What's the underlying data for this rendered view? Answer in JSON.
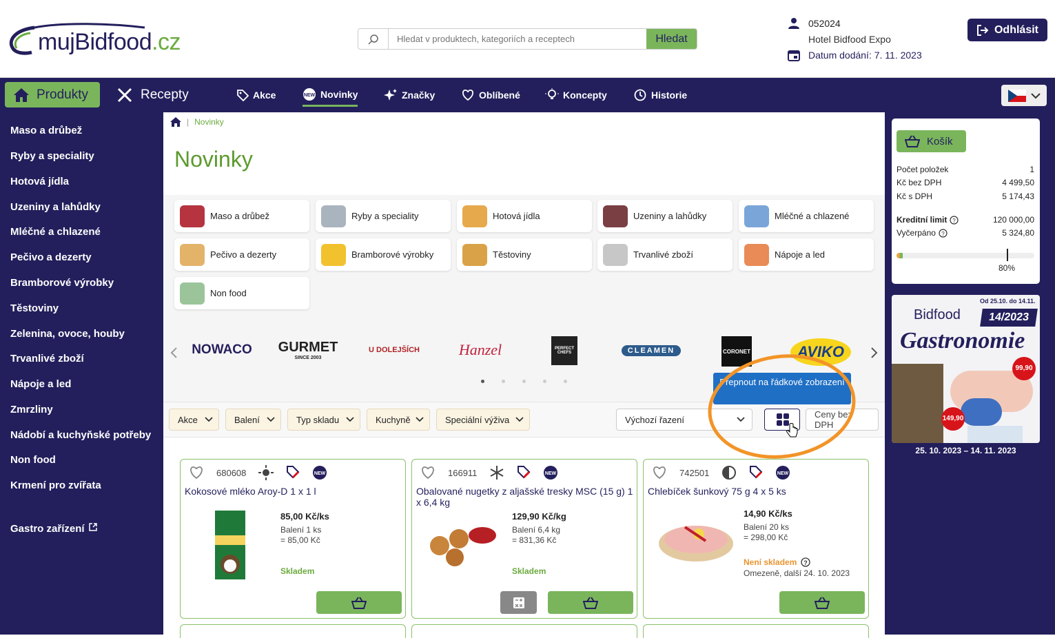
{
  "header": {
    "logo_main": "mujBidfood",
    "logo_suffix": ".cz",
    "search_placeholder": "Hledat v produktech, kategoriích a receptech",
    "search_button": "Hledat",
    "account_id": "052024",
    "account_name": "Hotel Bidfood Expo",
    "delivery_date": "Datum dodání: 7. 11. 2023",
    "logout_label": "Odhlásit"
  },
  "nav": {
    "products": "Produkty",
    "recipes": "Recepty",
    "items": [
      {
        "label": "Akce",
        "icon": "tag-icon"
      },
      {
        "label": "Novinky",
        "icon": "new-badge-icon",
        "active": true
      },
      {
        "label": "Značky",
        "icon": "sparkle-icon"
      },
      {
        "label": "Oblíbené",
        "icon": "heart-icon"
      },
      {
        "label": "Koncepty",
        "icon": "bulb-icon"
      },
      {
        "label": "Historie",
        "icon": "history-icon"
      }
    ]
  },
  "sidebar": {
    "categories": [
      "Maso a drůbež",
      "Ryby a speciality",
      "Hotová jídla",
      "Uzeniny a lahůdky",
      "Mléčné a chlazené",
      "Pečivo a dezerty",
      "Bramborové výrobky",
      "Těstoviny",
      "Zelenina, ovoce, houby",
      "Trvanlivé zboží",
      "Nápoje a led",
      "Zmrzliny",
      "Nádobí a kuchyňské potřeby",
      "Non food",
      "Krmení pro zvířata"
    ],
    "gastro": "Gastro zařízení"
  },
  "breadcrumb": {
    "current": "Novinky"
  },
  "page_title": "Novinky",
  "category_tiles": [
    "Maso a drůbež",
    "Ryby a speciality",
    "Hotová jídla",
    "Uzeniny a lahůdky",
    "Mléčné a chlazené",
    "Pečivo a dezerty",
    "Bramborové výrobky",
    "Těstoviny",
    "Trvanlivé zboží",
    "Nápoje a led",
    "Non food"
  ],
  "brands": [
    "NOWACO",
    "GURMET",
    "U DOLEJŠÍCH",
    "Hanzel",
    "PERFECT CHEFS",
    "CLEAMEN",
    "CORONET",
    "AVIKO"
  ],
  "brands_extra": {
    "gurmet_since": "SINCE 2003"
  },
  "filters": [
    "Akce",
    "Balení",
    "Typ skladu",
    "Kuchyně",
    "Speciální výživa"
  ],
  "sort": {
    "label": "Výchozí řazení",
    "price_toggle": "Ceny bez DPH"
  },
  "tooltip": "Přepnout na řádkové zobrazení",
  "products": [
    {
      "code": "680608",
      "name": "Kokosové mléko Aroy-D 1 x 1 l",
      "price": "85,00 Kč/ks",
      "pack": "Balení 1 ks",
      "total": "= 85,00 Kč",
      "stock": "Skladem",
      "storage_icon": "sun-icon"
    },
    {
      "code": "166911",
      "name": "Obalované nugetky z aljašské tresky MSC (15 g) 1 x 6,4 kg",
      "price": "129,90 Kč/kg",
      "pack": "Balení 6,4 kg",
      "total": "= 831,36 Kč",
      "stock": "Skladem",
      "storage_icon": "snowflake-icon"
    },
    {
      "code": "742501",
      "name": "Chlebíček šunkový 75 g 4 x 5 ks",
      "price": "14,90 Kč/ks",
      "pack": "Balení 20 ks",
      "total": "= 298,00 Kč",
      "stock": "Není skladem",
      "stock_note": "Omezeně, další 24. 10. 2023",
      "storage_icon": "half-snow-icon"
    }
  ],
  "cart": {
    "label": "Košík",
    "rows": [
      {
        "label": "Počet položek",
        "value": "1"
      },
      {
        "label": "Kč bez DPH",
        "value": "4 499,50"
      },
      {
        "label": "Kč s DPH",
        "value": "5 174,43"
      },
      {
        "label": "Kreditní limit",
        "value": "120 000,00"
      },
      {
        "label": "Vyčerpáno",
        "value": "5 324,80"
      }
    ],
    "credit_percent_label": "80%",
    "credit_used_fraction": 0.045,
    "credit_marker_fraction": 0.8
  },
  "promo": {
    "brand": "Bidfood",
    "issue": "14/2023",
    "dates_small": "Od 25.10. do 14.11.",
    "title": "Gastronomie",
    "price1": "99,90",
    "price2": "149,90",
    "range": "25. 10. 2023 – 14. 11. 2023"
  },
  "colors": {
    "navy": "#231f5c",
    "green": "#7ab55c",
    "orange": "#f29427",
    "tooltip": "#1f6fc5"
  }
}
